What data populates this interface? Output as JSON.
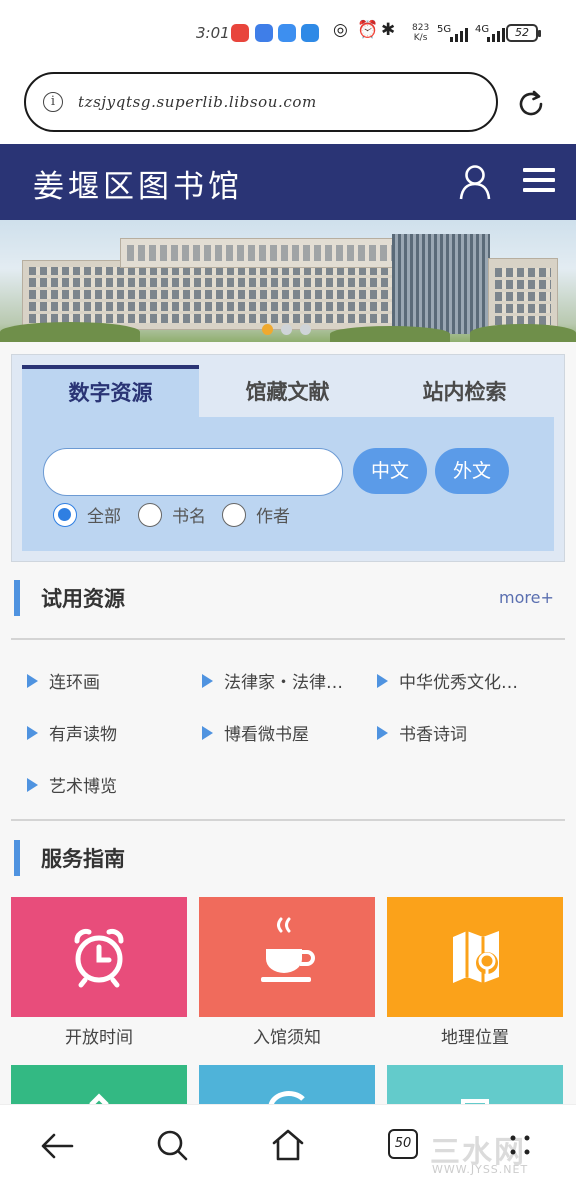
{
  "status_bar": {
    "time": "3:01",
    "net_speed_value": "823",
    "net_speed_unit": "K/s",
    "signal_1": "5G",
    "signal_2": "4G",
    "battery": "52"
  },
  "browser": {
    "url": "tzsjyqtsg.superlib.libsou.com",
    "info_icon": "i"
  },
  "site": {
    "title": "姜堰区图书馆"
  },
  "search": {
    "tabs": [
      {
        "label": "数字资源",
        "active": true
      },
      {
        "label": "馆藏文献",
        "active": false
      },
      {
        "label": "站内检索",
        "active": false
      }
    ],
    "input_value": "",
    "buttons": {
      "chinese": "中文",
      "foreign": "外文"
    },
    "scopes": [
      {
        "label": "全部",
        "checked": true
      },
      {
        "label": "书名",
        "checked": false
      },
      {
        "label": "作者",
        "checked": false
      }
    ]
  },
  "trial_resources": {
    "title": "试用资源",
    "more": "more+",
    "items": [
      {
        "label": "连环画"
      },
      {
        "label": "法律家・法律…"
      },
      {
        "label": "中华优秀文化…"
      },
      {
        "label": "有声读物"
      },
      {
        "label": "博看微书屋"
      },
      {
        "label": "书香诗词"
      },
      {
        "label": "艺术博览"
      }
    ]
  },
  "service_guide": {
    "title": "服务指南",
    "tiles": [
      {
        "label": "开放时间",
        "icon": "alarm-clock-icon",
        "color": "#e84d7b"
      },
      {
        "label": "入馆须知",
        "icon": "coffee-cup-icon",
        "color": "#f06b5c"
      },
      {
        "label": "地理位置",
        "icon": "map-icon",
        "color": "#fba21a"
      },
      {
        "label": "",
        "icon": "tile-icon-4",
        "color": "#33b983"
      },
      {
        "label": "",
        "icon": "tile-icon-5",
        "color": "#4fb3d9"
      },
      {
        "label": "",
        "icon": "tile-icon-6",
        "color": "#63cbcb"
      }
    ]
  },
  "bottom_nav": {
    "tab_count": "50",
    "watermark": "三水网",
    "watermark_sub": "WWW.JYSS.NET"
  },
  "colors": {
    "header_bg": "#2a3475",
    "accent_blue": "#4f93e0",
    "button_blue": "#5b9be8"
  }
}
